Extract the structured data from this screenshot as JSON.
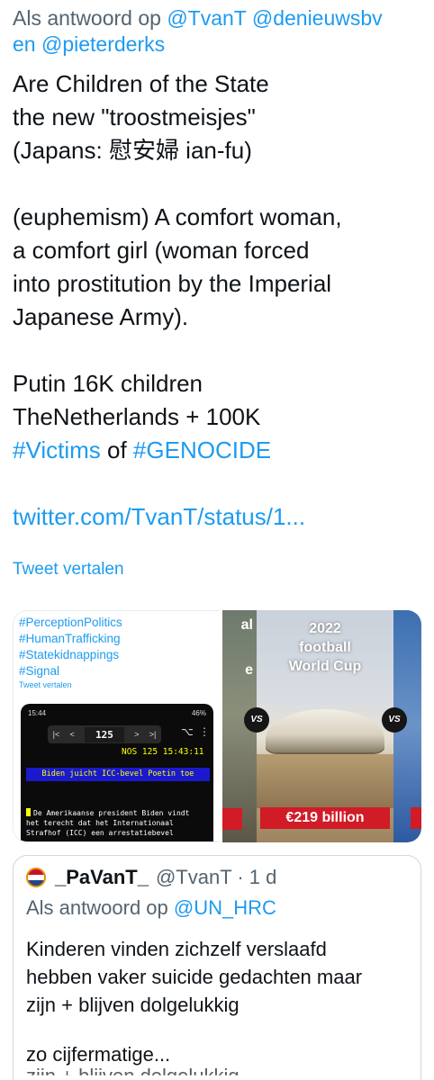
{
  "reply": {
    "prefix": "Als antwoord op ",
    "mentions": [
      "@TvanT",
      "@denieuwsbv",
      "en",
      "@pieterderks"
    ],
    "line1_rest": "@denieuwsbv",
    "line2_prefix": "en ",
    "line2_mention": "@pieterderks"
  },
  "tweet": {
    "lines": {
      "l1": "Are Children of the State",
      "l2": "the new \"troostmeisjes\"",
      "l3": "(Japans: 慰安婦 ian-fu)",
      "l4": "(euphemism) A comfort woman,",
      "l5": "a comfort girl (woman forced",
      "l6": "into prostitution by the Imperial",
      "l7": "Japanese Army).",
      "l8": "Putin 16K children",
      "l9": "TheNetherlands + 100K",
      "l10_tag1": "#Victims",
      "l10_mid": " of ",
      "l10_tag2": "#GENOCIDE",
      "link": "twitter.com/TvanT/status/1..."
    },
    "translate_label": "Tweet vertalen"
  },
  "media": {
    "left": {
      "hashtags": [
        "#PerceptionPolitics",
        "#HumanTrafficking",
        "#Statekidnappings",
        "#Signal"
      ],
      "translate_label": "Tweet vertalen",
      "phone": {
        "time": "15:44",
        "battery": "46%",
        "page_number": "125",
        "nos_line": "NOS 125 15:43:11",
        "headline": "Biden juicht ICC-bevel Poetin toe",
        "body_lines": [
          "De Amerikaanse president Biden vindt",
          "het terecht dat het Internationaal",
          "Strafhof (ICC) een arrestatiebevel"
        ]
      }
    },
    "right": {
      "left_fragment_1": "al",
      "left_fragment_2": "e",
      "title_line1": "2022",
      "title_line2": "football",
      "title_line3": "World Cup",
      "vs_label": "VS",
      "price": "€219 billion"
    }
  },
  "quote": {
    "display_name": "_PaVanT_",
    "handle_time": "@TvanT · 1 d",
    "reply_prefix": "Als antwoord op ",
    "reply_mention": "@UN_HRC",
    "lines": {
      "l1": "Kinderen vinden zichzelf verslaafd",
      "l2": "hebben vaker suicide gedachten maar",
      "l3": "zijn + blijven dolgelukkig",
      "l4": "zo cijfermatige...",
      "ghost": "zijn + blijven dolgelukkig"
    }
  },
  "colors": {
    "link": "#1d9bf0",
    "text": "#0f1419",
    "secondary": "#536471",
    "border": "#cfd9de",
    "price_bg": "#d11b27"
  }
}
